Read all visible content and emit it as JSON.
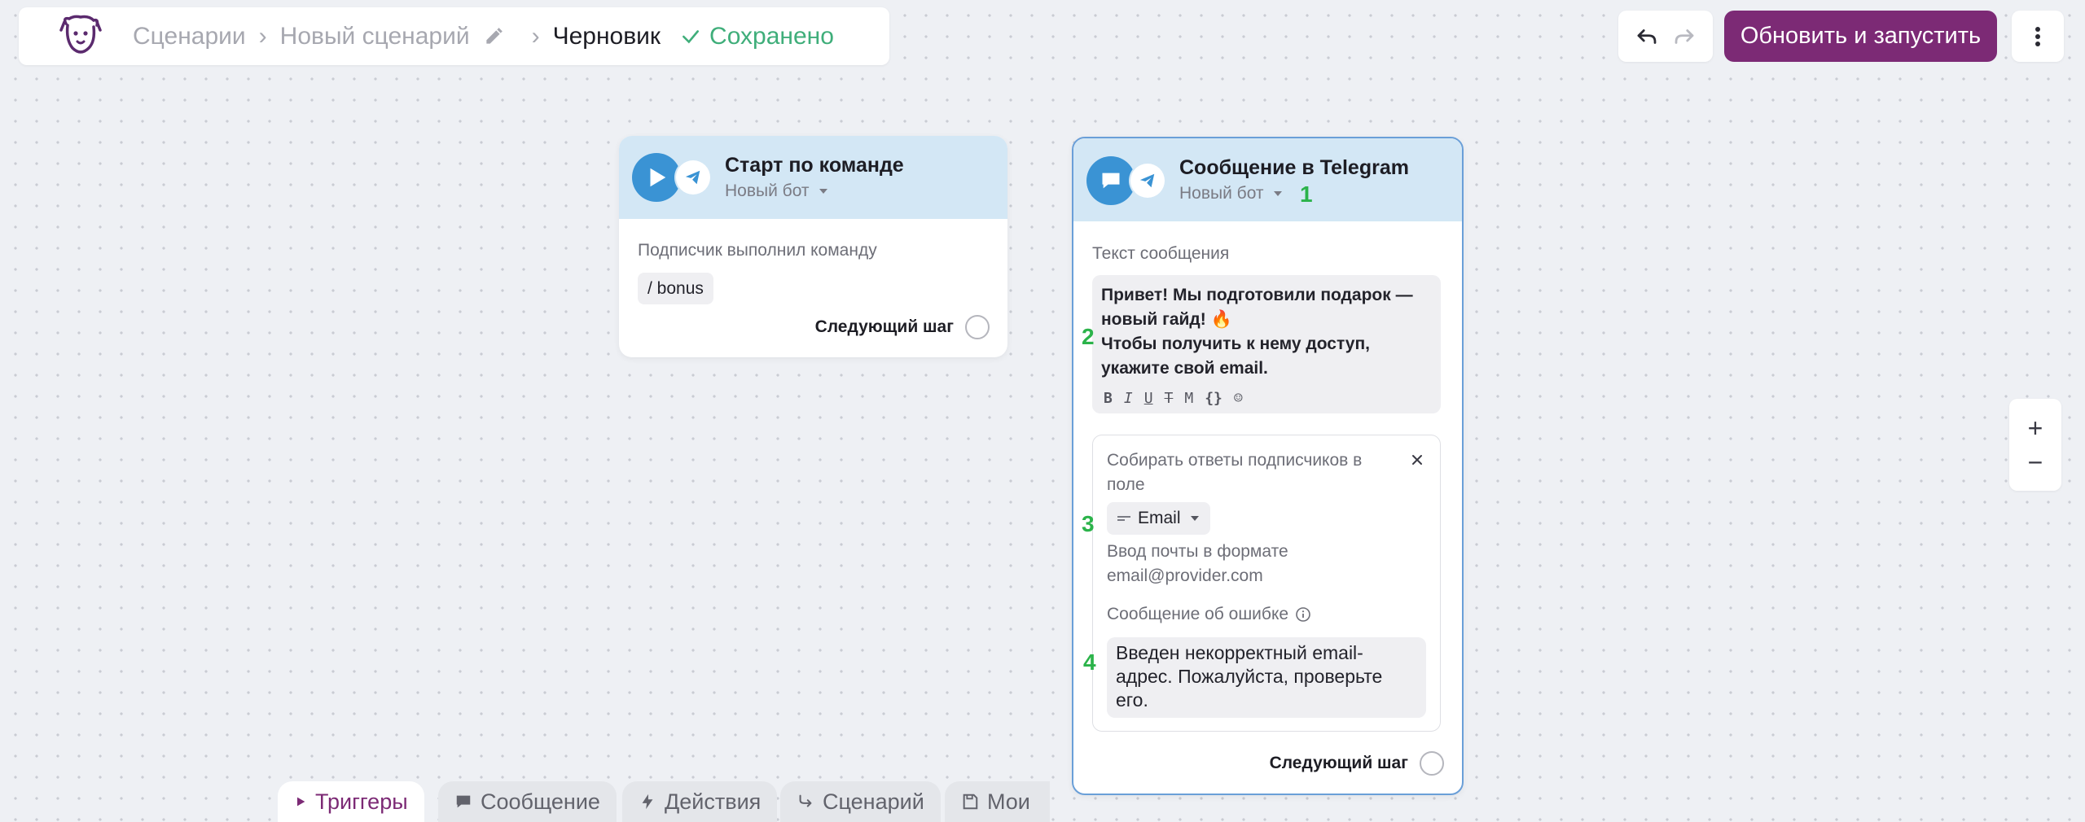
{
  "breadcrumb": {
    "item1": "Сценарии",
    "item2": "Новый сценарий",
    "current": "Черновик",
    "status": "Сохранено"
  },
  "toolbar": {
    "run_label": "Обновить и запустить"
  },
  "start_node": {
    "title": "Старт по команде",
    "bot": "Новый бот",
    "trigger_desc": "Подписчик выполнил команду",
    "command": "/ bonus",
    "next_step": "Следующий шаг"
  },
  "message_node": {
    "title": "Сообщение в Telegram",
    "bot": "Новый бот",
    "text_label": "Текст сообщения",
    "text_lines": [
      "Привет! Мы подготовили подарок  —",
      "новый гайд! 🔥",
      "Чтобы получить к нему доступ,",
      "укажите свой email."
    ],
    "format_buttons": [
      "B",
      "I",
      "U",
      "T",
      "M",
      "{}",
      "☺"
    ],
    "collect_line1": "Собирать ответы подписчиков в",
    "collect_line2": "поле",
    "field": "Email",
    "hint_line1": "Ввод почты в формате",
    "hint_line2": "email@provider.com",
    "error_label": "Сообщение об ошибке",
    "error_lines": [
      "Введен некорректный email-",
      "адрес. Пожалуйста, проверьте",
      "его."
    ],
    "next_step": "Следующий шаг"
  },
  "annotations": [
    "1",
    "2",
    "3",
    "4"
  ],
  "zoom": {
    "plus": "+",
    "minus": "−"
  },
  "bottom_tabs": [
    {
      "label": "Триггеры"
    },
    {
      "label": "Сообщение"
    },
    {
      "label": "Действия"
    },
    {
      "label": "Сценарий"
    },
    {
      "label": "Мои"
    }
  ],
  "colors": {
    "accent": "#7c2a75",
    "saved": "#3fae7a",
    "node_header": "#d3e7f5",
    "telegram_blue": "#3a93d4",
    "annotation": "#2bb34a"
  }
}
